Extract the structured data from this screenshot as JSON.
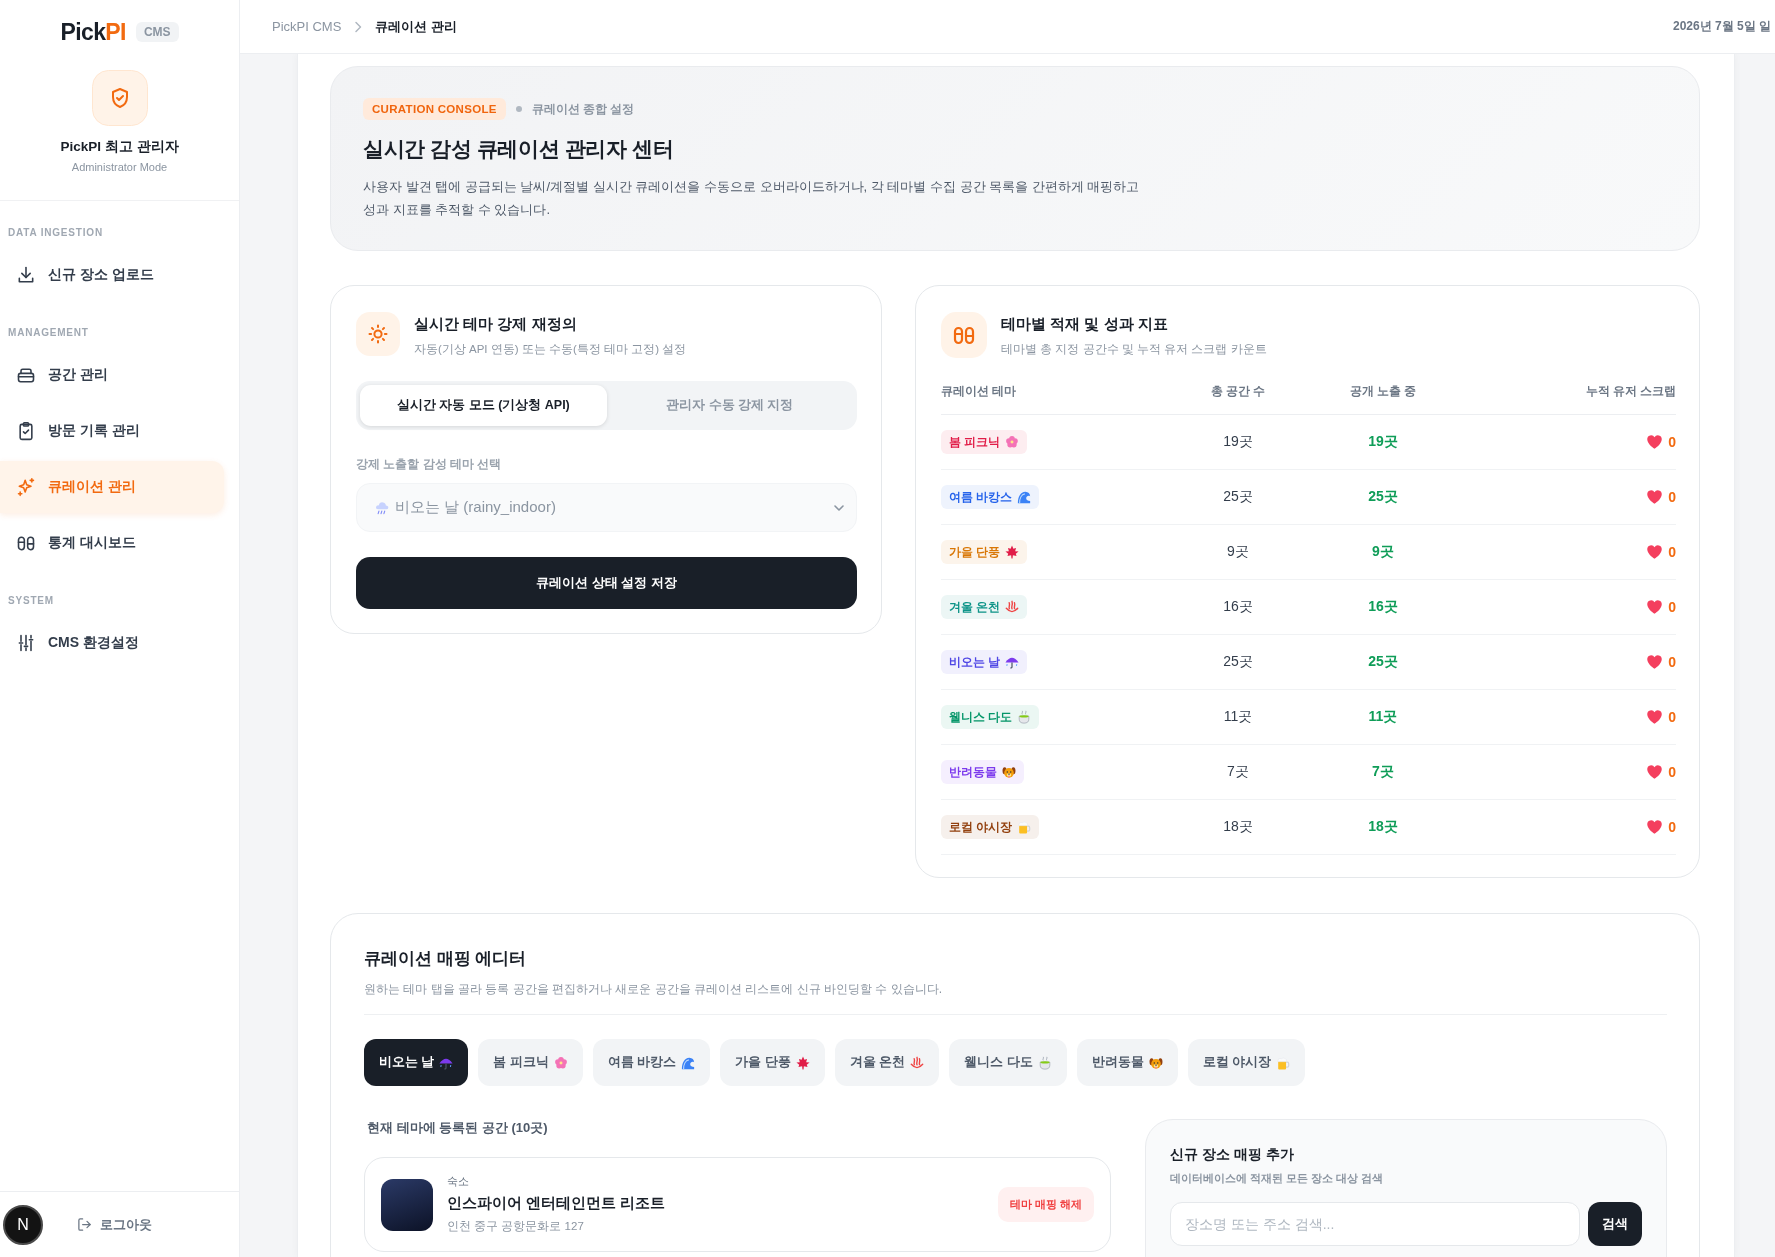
{
  "sidebar": {
    "logo": {
      "text": "Pick",
      "accent": "PI"
    },
    "badge": "CMS",
    "admin": {
      "name": "PickPI 최고 관리자",
      "mode": "Administrator Mode"
    },
    "sections": [
      {
        "title": "DATA INGESTION",
        "items": [
          {
            "label": "신규 장소 업로드",
            "kind": "download",
            "selected": false
          }
        ]
      },
      {
        "title": "MANAGEMENT",
        "items": [
          {
            "label": "공간 관리",
            "kind": "box",
            "selected": false
          },
          {
            "label": "방문 기록 관리",
            "kind": "clipboard",
            "selected": false
          },
          {
            "label": "큐레이션 관리",
            "kind": "sparkle",
            "selected": true
          },
          {
            "label": "통계 대시보드",
            "kind": "capsules",
            "selected": false
          }
        ]
      },
      {
        "title": "SYSTEM",
        "items": [
          {
            "label": "CMS 환경설정",
            "kind": "sliders",
            "selected": false
          }
        ]
      }
    ],
    "footer": {
      "avatar": "N",
      "logout": "로그아웃"
    }
  },
  "header": {
    "breadcrumb": [
      "PickPI CMS",
      "큐레이션 관리"
    ],
    "date": "2026년 7월 5일 일"
  },
  "hero": {
    "badge": "CURATION CONSOLE",
    "tag": "큐레이션 종합 설정",
    "title": "실시간 감성 큐레이션 관리자 센터",
    "description": "사용자 발견 탭에 공급되는 날씨/계절별 실시간 큐레이션을 수동으로 오버라이드하거나, 각 테마별 수집 공간 목록을 간편하게 매핑하고 성과 지표를 추적할 수 있습니다."
  },
  "override_card": {
    "title": "실시간 테마 강제 재정의",
    "subtitle": "자동(기상 API 연동) 또는 수동(특정 테마 고정) 설정",
    "modes": [
      {
        "label": "실시간 자동 모드 (기상청 API)",
        "selected": true
      },
      {
        "label": "관리자 수동 강제 지정",
        "selected": false
      }
    ],
    "select": {
      "label": "강제 노출할 감성 테마 선택",
      "value": "비오는 날 (rainy_indoor)",
      "kind": "rain-cloud",
      "disabled": true
    },
    "save_button": "큐레이션 상태 설정 저장"
  },
  "metrics_card": {
    "title": "테마별 적재 및 성과 지표",
    "subtitle": "테마별 총 지정 공간수 및 누적 유저 스크랩 카운트",
    "columns": [
      "큐레이션 테마",
      "총 공간 수",
      "공개 노출 중",
      "누적 유저 스크랩"
    ],
    "rows": [
      {
        "theme": "봄 피크닉",
        "kind": "blossom",
        "color": "#e11d48",
        "total": "19곳",
        "public": "19곳",
        "scraps": "0"
      },
      {
        "theme": "여름 바캉스",
        "kind": "wave",
        "color": "#2563eb",
        "total": "25곳",
        "public": "25곳",
        "scraps": "0"
      },
      {
        "theme": "가을 단풍",
        "kind": "maple",
        "color": "#d97706",
        "total": "9곳",
        "public": "9곳",
        "scraps": "0"
      },
      {
        "theme": "겨울 온천",
        "kind": "hot-spring",
        "color": "#0d9488",
        "total": "16곳",
        "public": "16곳",
        "scraps": "0"
      },
      {
        "theme": "비오는 날",
        "kind": "umbrella",
        "color": "#4f46e5",
        "total": "25곳",
        "public": "25곳",
        "scraps": "0"
      },
      {
        "theme": "웰니스 다도",
        "kind": "tea",
        "color": "#059669",
        "total": "11곳",
        "public": "11곳",
        "scraps": "0"
      },
      {
        "theme": "반려동물",
        "kind": "dog",
        "color": "#7c3aed",
        "total": "7곳",
        "public": "7곳",
        "scraps": "0"
      },
      {
        "theme": "로컬 야시장",
        "kind": "beer",
        "color": "#92400e",
        "total": "18곳",
        "public": "18곳",
        "scraps": "0"
      }
    ]
  },
  "mapping_editor": {
    "title": "큐레이션 매핑 에디터",
    "description": "원하는 테마 탭을 골라 등록 공간을 편집하거나 새로운 공간을 큐레이션 리스트에 신규 바인딩할 수 있습니다.",
    "tabs": [
      {
        "label": "비오는 날",
        "kind": "umbrella",
        "selected": true
      },
      {
        "label": "봄 피크닉",
        "kind": "blossom",
        "selected": false
      },
      {
        "label": "여름 바캉스",
        "kind": "wave",
        "selected": false
      },
      {
        "label": "가을 단풍",
        "kind": "maple",
        "selected": false
      },
      {
        "label": "겨울 온천",
        "kind": "hot-spring",
        "selected": false
      },
      {
        "label": "웰니스 다도",
        "kind": "tea",
        "selected": false
      },
      {
        "label": "반려동물",
        "kind": "dog",
        "selected": false
      },
      {
        "label": "로컬 야시장",
        "kind": "beer",
        "selected": false
      }
    ],
    "list_title": "현재 테마에 등록된 공간 (10곳)",
    "places": [
      {
        "category": "숙소",
        "name": "인스파이어 엔터테인먼트 리조트",
        "address": "인천 중구 공항문화로 127",
        "action": "테마 매핑 해제"
      }
    ],
    "add_panel": {
      "title": "신규 장소 매핑 추가",
      "subtitle": "데이터베이스에 적재된 모든 장소 대상 검색",
      "search": {
        "placeholder": "장소명 또는 주소 검색..."
      },
      "button": "검색"
    }
  }
}
